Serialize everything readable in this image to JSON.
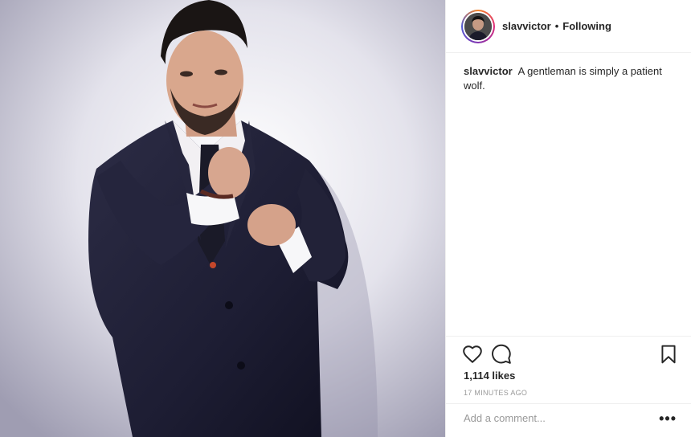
{
  "post": {
    "username": "slavvictor",
    "separator": "•",
    "follow_status": "Following",
    "caption_username": "slavvictor",
    "caption_text": "A gentleman is simply a patient wolf.",
    "likes": "1,114 likes",
    "time_ago": "17 MINUTES AGO",
    "comment_placeholder": "Add a comment...",
    "more_label": "•••"
  },
  "icons": {
    "like": "heart-icon",
    "comment": "comment-icon",
    "save": "bookmark-icon",
    "more": "more-options-icon"
  },
  "colors": {
    "text": "#262626",
    "muted": "#999999",
    "border": "#efefef"
  }
}
